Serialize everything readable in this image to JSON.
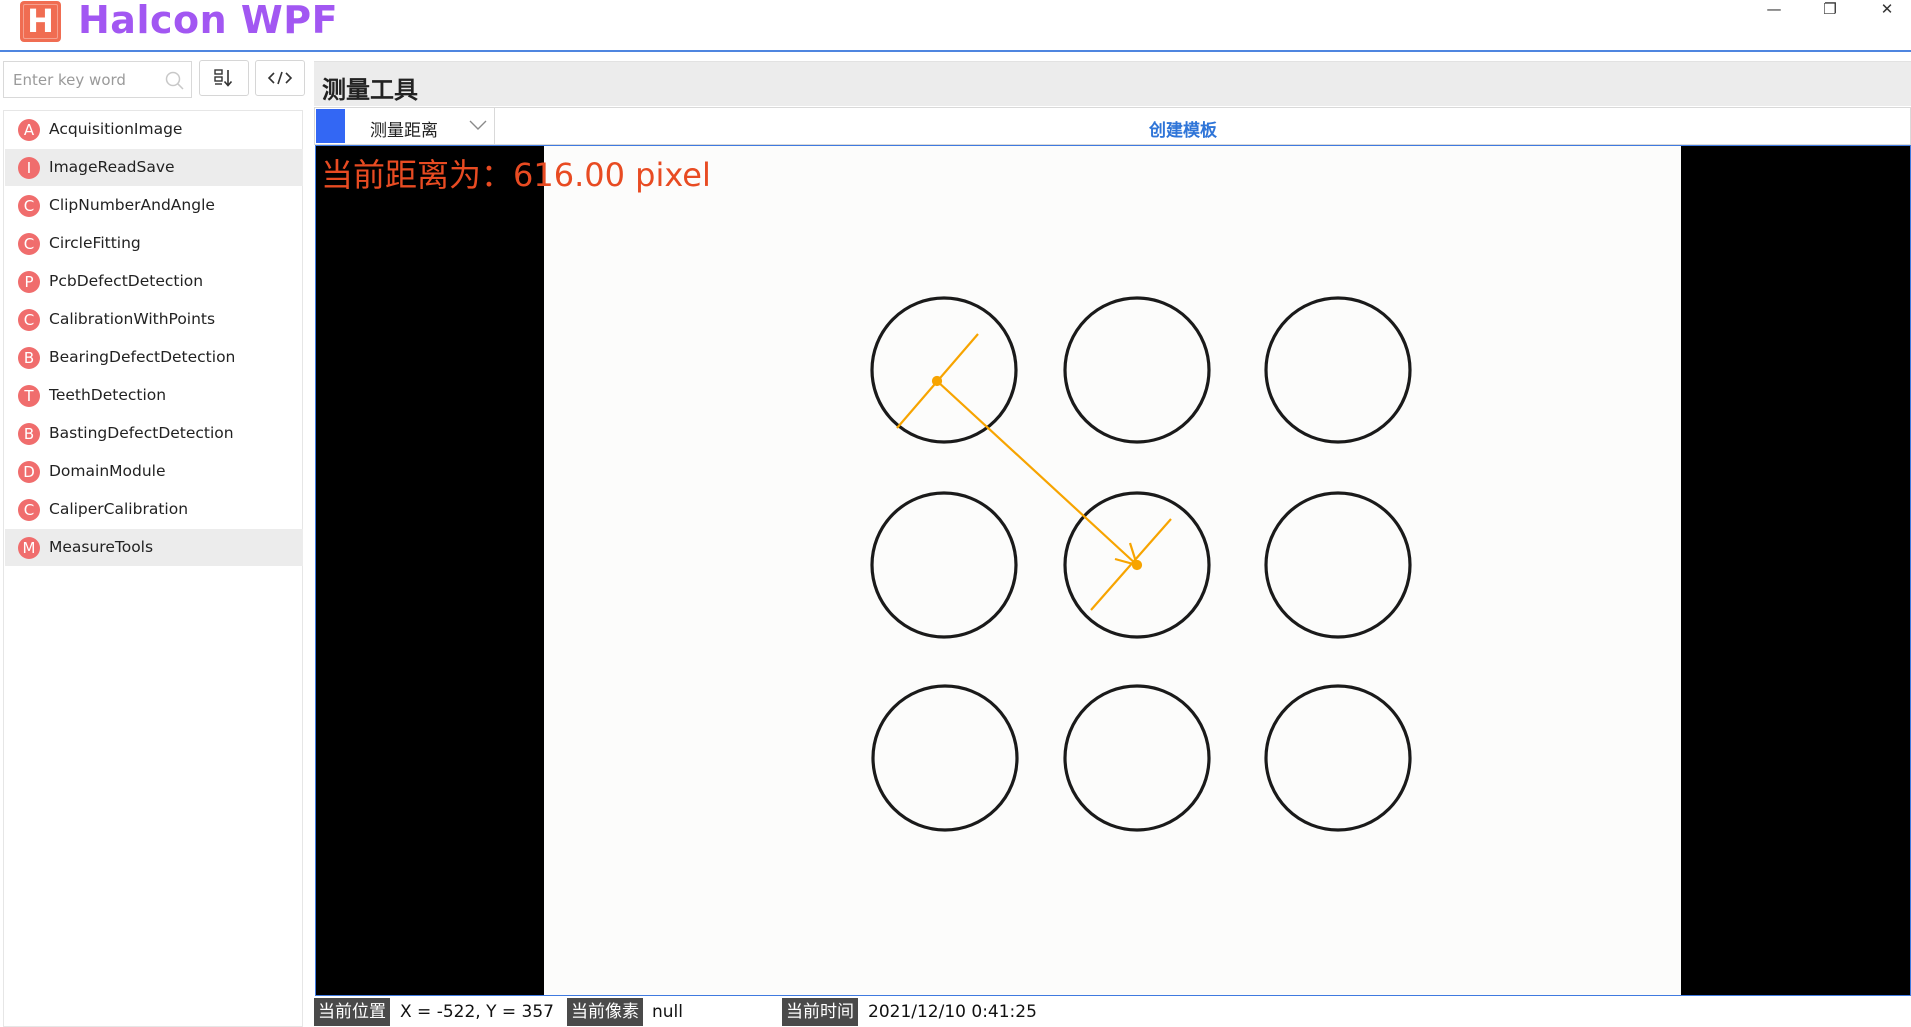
{
  "window": {
    "logo_letter": "H",
    "title": "Halcon WPF",
    "controls": {
      "minimize": "—",
      "restore": "❐",
      "close": "✕"
    }
  },
  "sidebar": {
    "search_placeholder": "Enter key word",
    "sort_icon": "sort-icon",
    "code_icon": "code-icon",
    "items": [
      {
        "letter": "A",
        "label": "AcquisitionImage",
        "active": false
      },
      {
        "letter": "I",
        "label": "ImageReadSave",
        "active": true
      },
      {
        "letter": "C",
        "label": "ClipNumberAndAngle",
        "active": false
      },
      {
        "letter": "C",
        "label": "CircleFitting",
        "active": false
      },
      {
        "letter": "P",
        "label": "PcbDefectDetection",
        "active": false
      },
      {
        "letter": "C",
        "label": "CalibrationWithPoints",
        "active": false
      },
      {
        "letter": "B",
        "label": "BearingDefectDetection",
        "active": false
      },
      {
        "letter": "T",
        "label": "TeethDetection",
        "active": false
      },
      {
        "letter": "B",
        "label": "BastingDefectDetection",
        "active": false
      },
      {
        "letter": "D",
        "label": "DomainModule",
        "active": false
      },
      {
        "letter": "C",
        "label": "CaliperCalibration",
        "active": false
      },
      {
        "letter": "M",
        "label": "MeasureTools",
        "active": true
      }
    ]
  },
  "main": {
    "title": "测量工具",
    "toolbar": {
      "color": "#3367f4",
      "mode_value": "测量距离",
      "create_button": "创建模板"
    },
    "viewer": {
      "distance_label": "当前距离为：616.00 pixel",
      "overlay_color": "#f7a400"
    },
    "status": {
      "position_label": "当前位置",
      "position_value": "X = -522, Y = 357",
      "pixel_label": "当前像素",
      "pixel_value": "null",
      "time_label": "当前时间",
      "time_value": "2021/12/10 0:41:25"
    }
  },
  "colors": {
    "accent": "#4f86e0",
    "title_text": "#a257f2",
    "badge": "#f06d6d",
    "distance_text": "#e84b22",
    "link": "#2f75d8"
  }
}
